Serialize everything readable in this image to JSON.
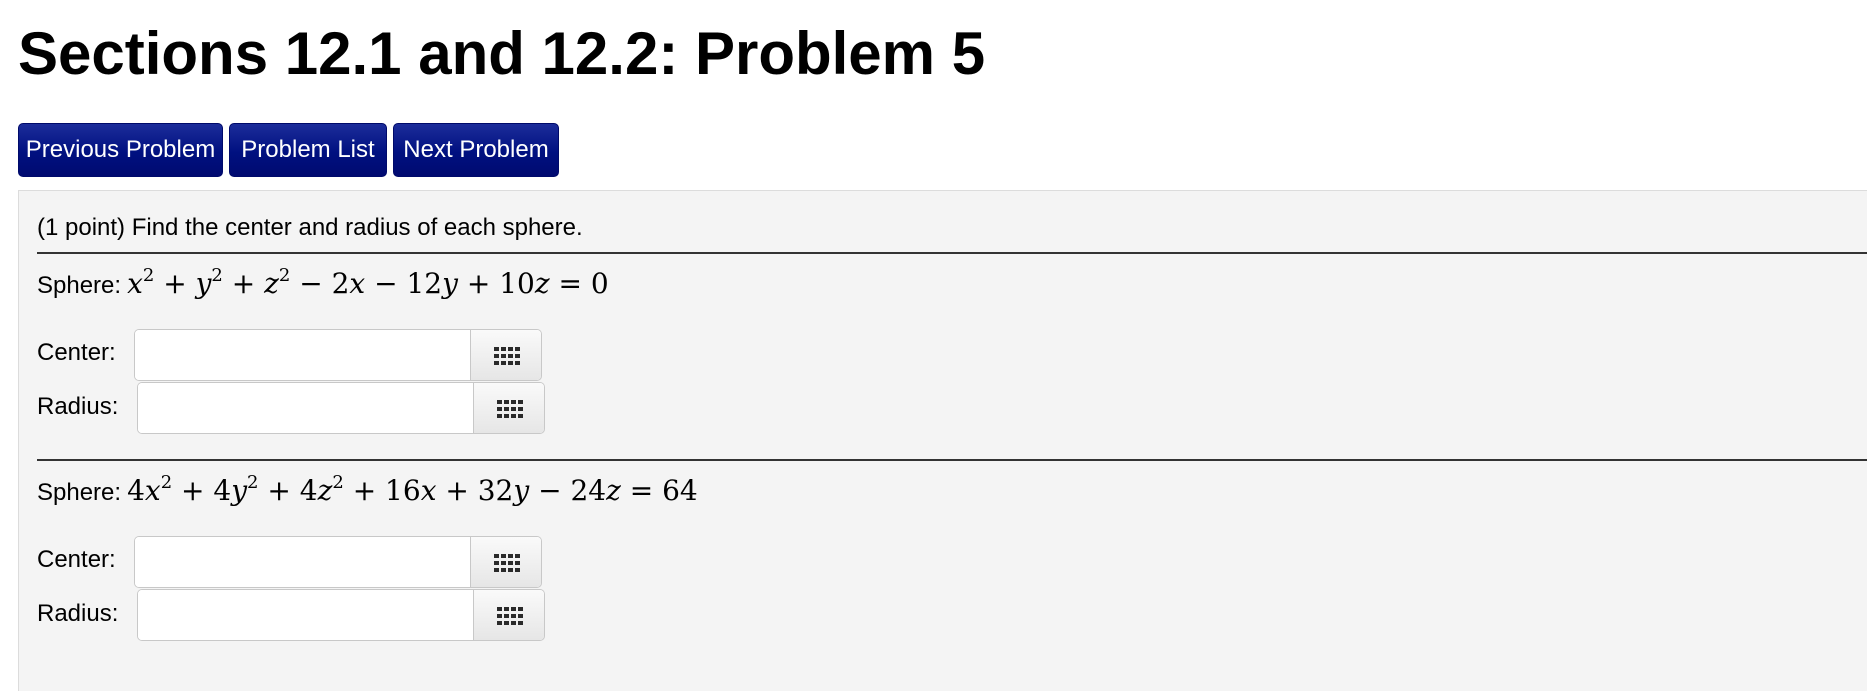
{
  "page": {
    "title": "Sections 12.1 and 12.2: Problem 5"
  },
  "nav": {
    "previous_label": "Previous Problem",
    "list_label": "Problem List",
    "next_label": "Next Problem",
    "button_color": "#001080"
  },
  "problem": {
    "intro": "(1 point) Find the center and radius of each sphere.",
    "spheres": [
      {
        "label": "Sphere:",
        "equation": "x^2 + y^2 + z^2 - 2x - 12y + 10z = 0",
        "center_label": "Center:",
        "center_value": "",
        "radius_label": "Radius:",
        "radius_value": ""
      },
      {
        "label": "Sphere:",
        "equation": "4x^2 + 4y^2 + 4z^2 + 16x + 32y - 24z = 64",
        "center_label": "Center:",
        "center_value": "",
        "radius_label": "Radius:",
        "radius_value": ""
      }
    ]
  },
  "icons": {
    "equation_editor": "grid-icon"
  }
}
